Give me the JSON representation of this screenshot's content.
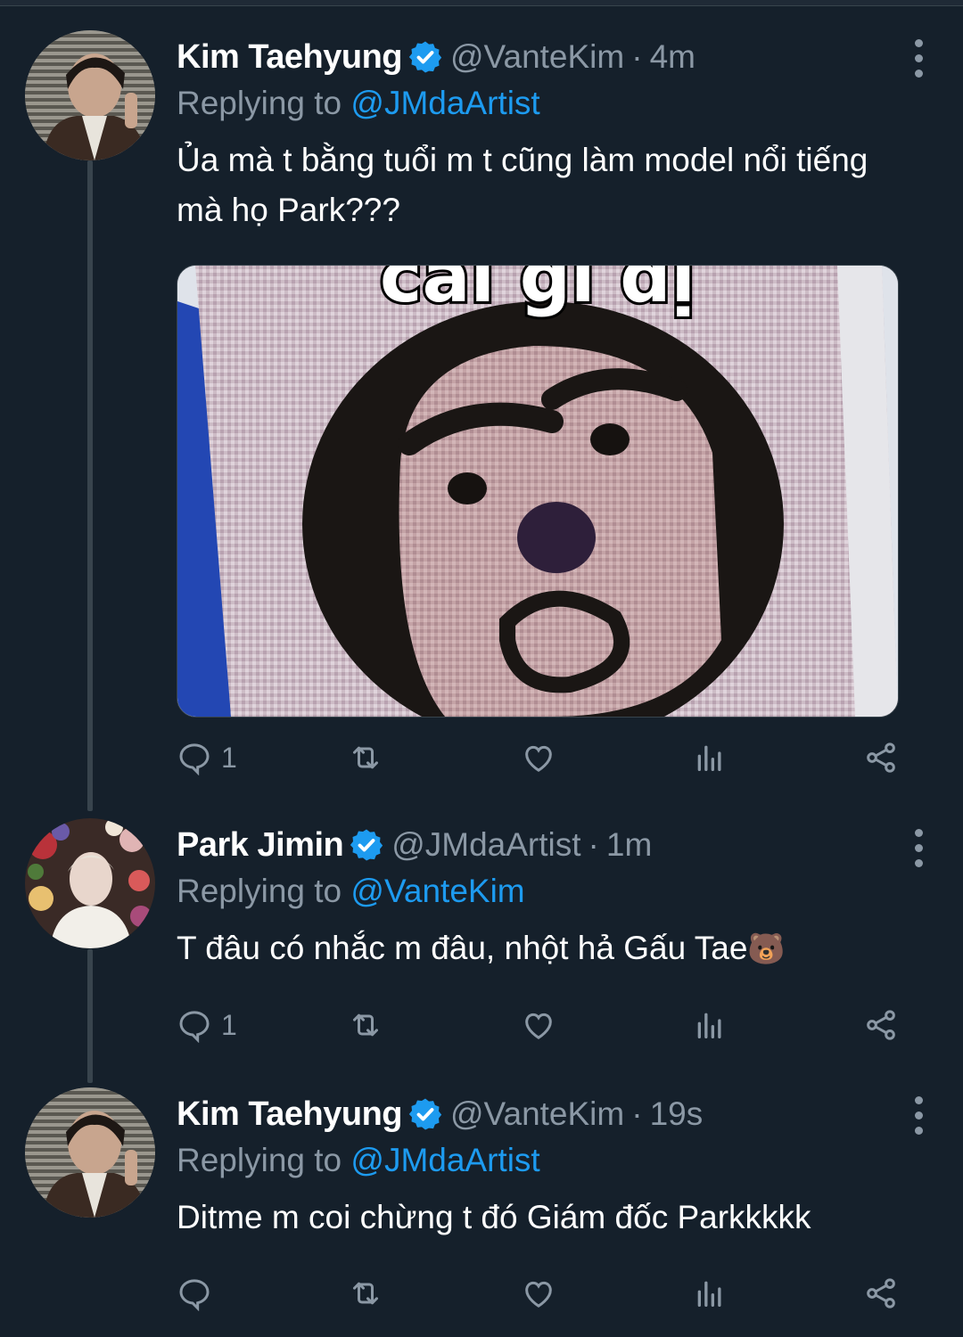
{
  "accent_color": "#1d9bf0",
  "background_color": "#15202b",
  "reply_prefix": "Replying to",
  "tweets": [
    {
      "name": "Kim Taehyung",
      "verified": true,
      "handle": "@VanteKim",
      "separator": "·",
      "time": "4m",
      "replying_to": "@JMdaArtist",
      "text": "Ủa mà t bằng tuổi m t cũng làm model nổi tiếng mà họ Park???",
      "media_caption": "cái gì dị",
      "actions": {
        "reply": "1",
        "retweet": "",
        "like": "",
        "views": "",
        "share": ""
      }
    },
    {
      "name": "Park Jimin",
      "verified": true,
      "handle": "@JMdaArtist",
      "separator": "·",
      "time": "1m",
      "replying_to": "@VanteKim",
      "text": "T đâu có nhắc m đâu, nhột hả Gấu Tae",
      "emoji": "🐻",
      "actions": {
        "reply": "1",
        "retweet": "",
        "like": "",
        "views": "",
        "share": ""
      }
    },
    {
      "name": "Kim Taehyung",
      "verified": true,
      "handle": "@VanteKim",
      "separator": "·",
      "time": "19s",
      "replying_to": "@JMdaArtist",
      "text": "Ditme m coi chừng t đó Giám đốc Parkkkkk",
      "actions": {
        "reply": "",
        "retweet": "",
        "like": "",
        "views": "",
        "share": ""
      }
    }
  ],
  "icons": {
    "verified": "verified-badge-icon",
    "more": "more-vertical-icon",
    "reply": "reply-bubble-icon",
    "retweet": "retweet-icon",
    "like": "heart-icon",
    "views": "bar-chart-icon",
    "share": "share-icon"
  }
}
